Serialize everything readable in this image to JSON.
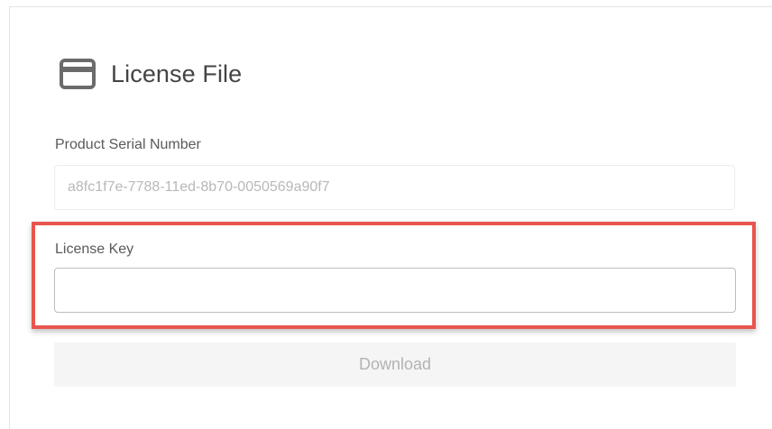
{
  "header": {
    "title": "License File",
    "icon": "credit-card-icon"
  },
  "serial": {
    "label": "Product Serial Number",
    "value": "a8fc1f7e-7788-11ed-8b70-0050569a90f7"
  },
  "license_key": {
    "label": "License Key",
    "value": "",
    "placeholder": ""
  },
  "download": {
    "label": "Download",
    "disabled": true
  },
  "colors": {
    "highlight_border": "#e8554e",
    "icon": "#6b6b6b",
    "disabled_button_bg": "#f5f5f5"
  }
}
